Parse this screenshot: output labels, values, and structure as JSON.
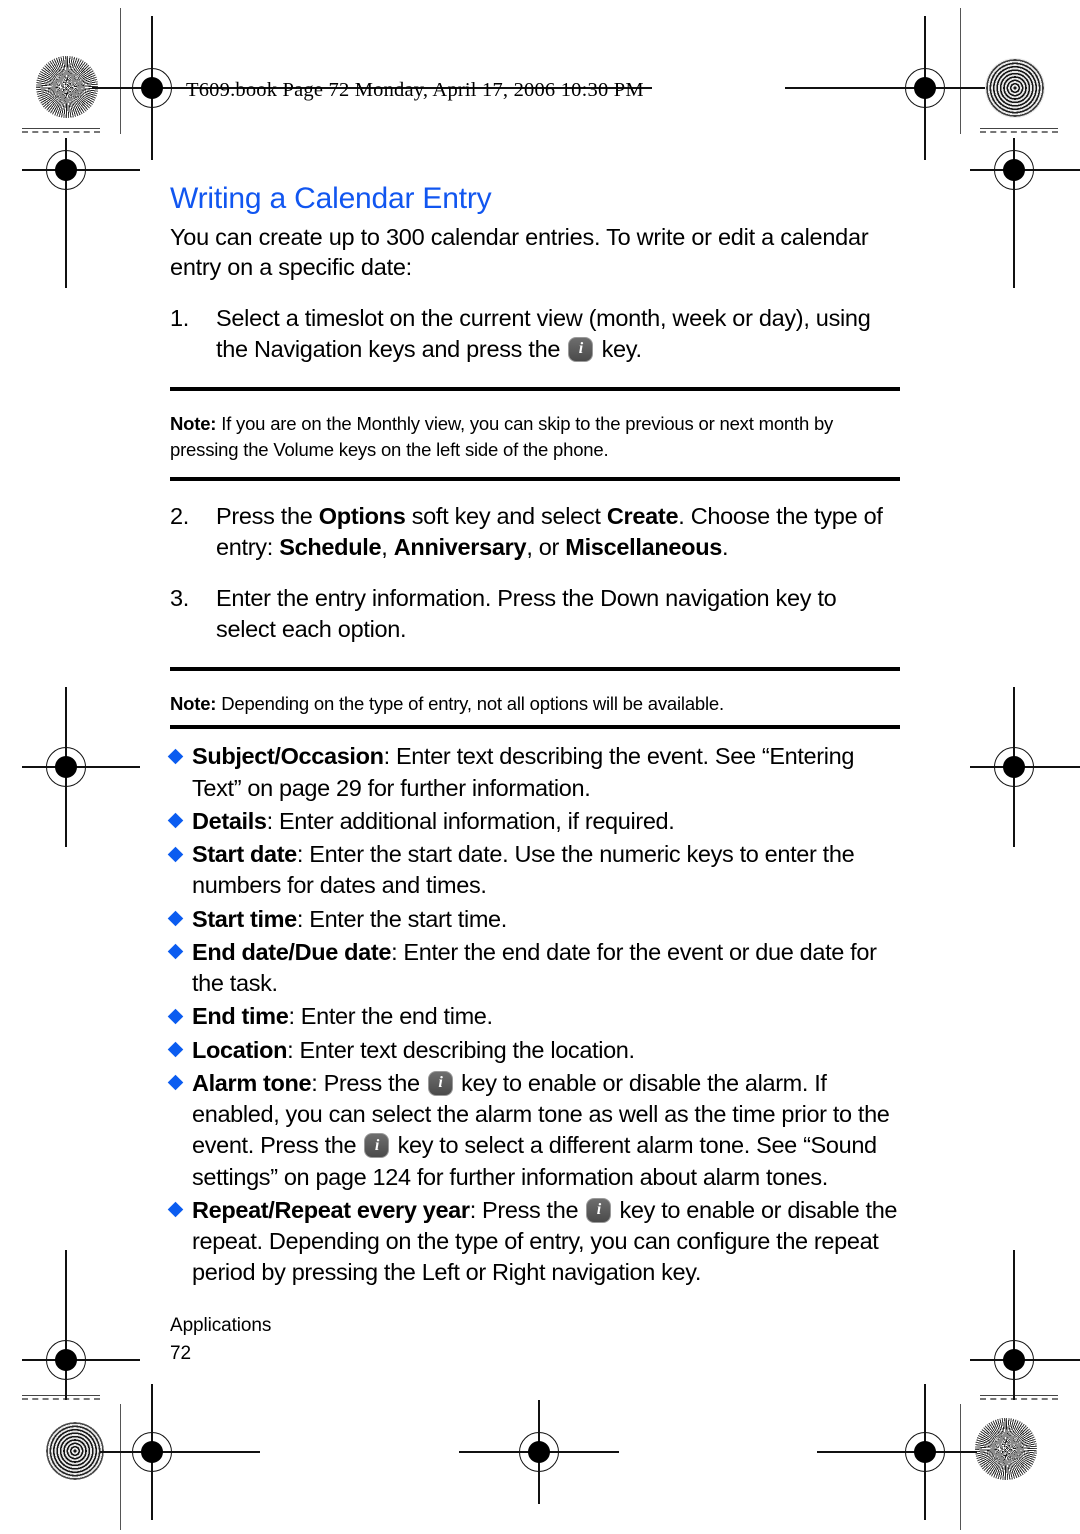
{
  "page": {
    "header_line": "T609.book  Page 72  Monday, April 17, 2006  10:30 PM",
    "title": "Writing a Calendar Entry",
    "intro": "You can create up to 300 calendar entries. To write or edit a calendar entry on a specific date:",
    "footer_section": "Applications",
    "footer_page_number": "72"
  },
  "colors": {
    "title_blue": "#1156f0",
    "bullet_blue": "#0b5cf0",
    "rule_black": "#000000",
    "key_glyph_gray": "#5a5a5a"
  },
  "steps": [
    {
      "number": "1.",
      "parts": [
        {
          "type": "text",
          "value": "Select a timeslot on the current view (month, week or day), using the Navigation keys and press the "
        },
        {
          "type": "icon",
          "value": "select-key-icon"
        },
        {
          "type": "text",
          "value": " key."
        }
      ]
    },
    {
      "number": "2.",
      "parts": [
        {
          "type": "text",
          "value": "Press the "
        },
        {
          "type": "bold",
          "value": "Options"
        },
        {
          "type": "text",
          "value": " soft key and select "
        },
        {
          "type": "bold",
          "value": "Create"
        },
        {
          "type": "text",
          "value": ". Choose the type of entry: "
        },
        {
          "type": "bold",
          "value": "Schedule"
        },
        {
          "type": "text",
          "value": ", "
        },
        {
          "type": "bold",
          "value": "Anniversary"
        },
        {
          "type": "text",
          "value": ", or "
        },
        {
          "type": "bold",
          "value": "Miscellaneous"
        },
        {
          "type": "text",
          "value": "."
        }
      ]
    },
    {
      "number": "3.",
      "parts": [
        {
          "type": "text",
          "value": "Enter the entry information. Press the Down navigation key to select each option."
        }
      ]
    }
  ],
  "notes": [
    {
      "label": "Note:",
      "text": " If you are on the Monthly view, you can skip to the previous or next month by pressing the Volume keys on the left side of the phone."
    },
    {
      "label": "Note:",
      "text": " Depending on the type of entry, not all options will be available."
    }
  ],
  "bullets": [
    {
      "parts": [
        {
          "type": "bold",
          "value": "Subject/Occasion"
        },
        {
          "type": "text",
          "value": ": Enter text describing the event. See “Entering Text” on page 29 for further information."
        }
      ]
    },
    {
      "parts": [
        {
          "type": "bold",
          "value": "Details"
        },
        {
          "type": "text",
          "value": ": Enter additional information, if required."
        }
      ]
    },
    {
      "parts": [
        {
          "type": "bold",
          "value": "Start date"
        },
        {
          "type": "text",
          "value": ": Enter the start date. Use the numeric keys to enter the numbers for dates and times."
        }
      ]
    },
    {
      "parts": [
        {
          "type": "bold",
          "value": "Start time"
        },
        {
          "type": "text",
          "value": ": Enter the start time."
        }
      ]
    },
    {
      "parts": [
        {
          "type": "bold",
          "value": "End date/Due date"
        },
        {
          "type": "text",
          "value": ": Enter the end date for the event or due date for the task."
        }
      ]
    },
    {
      "parts": [
        {
          "type": "bold",
          "value": "End time"
        },
        {
          "type": "text",
          "value": ": Enter the end time."
        }
      ]
    },
    {
      "parts": [
        {
          "type": "bold",
          "value": "Location"
        },
        {
          "type": "text",
          "value": ": Enter text describing the location."
        }
      ]
    },
    {
      "parts": [
        {
          "type": "bold",
          "value": "Alarm tone"
        },
        {
          "type": "text",
          "value": ": Press the "
        },
        {
          "type": "icon",
          "value": "select-key-icon"
        },
        {
          "type": "text",
          "value": " key to enable or disable the alarm. If enabled, you can select the alarm tone as well as the time prior to the event. Press the "
        },
        {
          "type": "icon",
          "value": "select-key-icon"
        },
        {
          "type": "text",
          "value": " key to select a different alarm tone. See “Sound settings” on page 124 for further information about alarm tones."
        }
      ]
    },
    {
      "parts": [
        {
          "type": "bold",
          "value": "Repeat/Repeat every year"
        },
        {
          "type": "text",
          "value": ": Press the "
        },
        {
          "type": "icon",
          "value": "select-key-icon"
        },
        {
          "type": "text",
          "value": " key to enable or disable the repeat. Depending on the type of entry, you can configure the repeat period by pressing the Left or Right navigation key."
        }
      ]
    }
  ],
  "print_marks": {
    "registration_targets": 8,
    "rosettes": [
      "star-rosette-top-left",
      "moire-rosette-top-right",
      "moire-rosette-bottom-left",
      "star-rosette-bottom-right"
    ]
  }
}
